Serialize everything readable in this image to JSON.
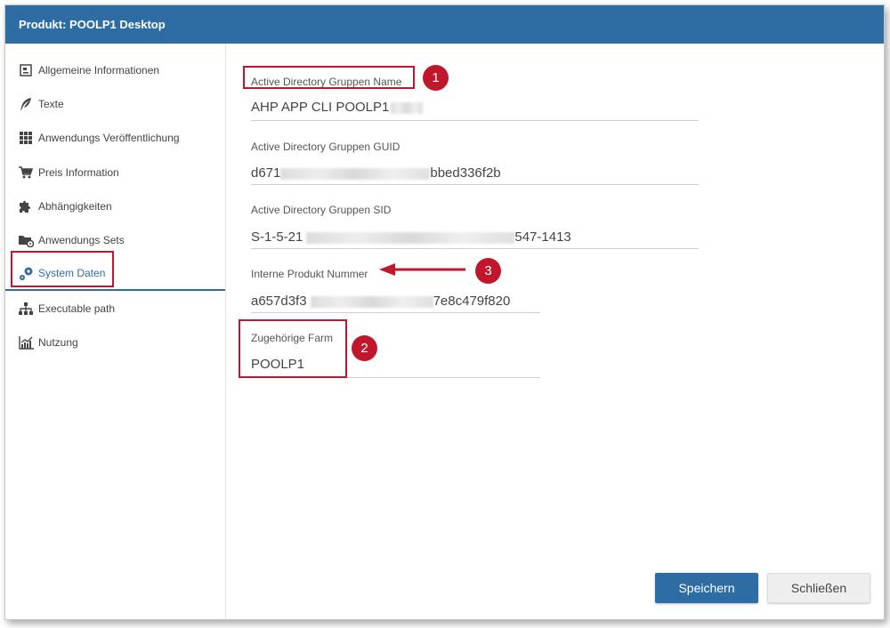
{
  "window": {
    "title": "Produkt: POOLP1 Desktop"
  },
  "sidebar": {
    "items": [
      {
        "label": "Allgemeine Informationen",
        "icon": "document-icon"
      },
      {
        "label": "Texte",
        "icon": "feather-icon"
      },
      {
        "label": "Anwendungs Veröffentlichung",
        "icon": "grid-icon"
      },
      {
        "label": "Preis Information",
        "icon": "cart-icon"
      },
      {
        "label": "Abhängigkeiten",
        "icon": "puzzle-icon"
      },
      {
        "label": "Anwendungs Sets",
        "icon": "folder-gear-icon"
      },
      {
        "label": "System Daten",
        "icon": "gears-icon",
        "active": true
      },
      {
        "label": "Executable path",
        "icon": "sitemap-icon"
      },
      {
        "label": "Nutzung",
        "icon": "chart-icon"
      }
    ]
  },
  "fields": {
    "ad_name": {
      "label": "Active Directory Gruppen Name",
      "value": "AHP APP CLI POOLP1"
    },
    "ad_guid": {
      "label": "Active Directory Gruppen GUID",
      "value_start": "d671",
      "value_end": "bbed336f2b"
    },
    "ad_sid": {
      "label": "Active Directory Gruppen SID",
      "value_start": "S-1-5-21",
      "value_end": "547-1413"
    },
    "product_number": {
      "label": "Interne Produkt Nummer",
      "value_start": "a657d3f3",
      "value_end": "7e8c479f820"
    },
    "farm": {
      "label": "Zugehörige Farm",
      "value": "POOLP1"
    }
  },
  "annotations": {
    "badge1": "1",
    "badge2": "2",
    "badge3": "3"
  },
  "buttons": {
    "save": "Speichern",
    "close": "Schließen"
  },
  "colors": {
    "primary": "#2e6da4",
    "annotation": "#c0172c"
  }
}
